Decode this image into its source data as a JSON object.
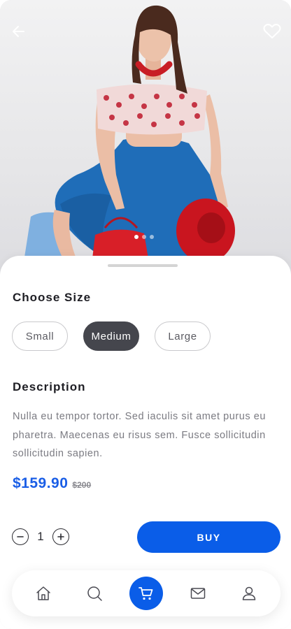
{
  "hero": {
    "back_icon": "arrow-left-icon",
    "favorite_icon": "heart-outline-icon",
    "carousel": {
      "count": 3,
      "active_index": 0
    }
  },
  "size_section": {
    "title": "Choose Size",
    "options": [
      "Small",
      "Medium",
      "Large"
    ],
    "selected": "Medium"
  },
  "description_section": {
    "title": "Description",
    "text": "Nulla eu tempor tortor. Sed iaculis sit amet purus eu pharetra. Maecenas eu risus sem. Fusce sollicitudin sollicitudin sapien."
  },
  "pricing": {
    "price": "$159.90",
    "old_price": "$200"
  },
  "quantity": {
    "value": "1",
    "decrement_icon": "minus-circle-icon",
    "increment_icon": "plus-circle-icon"
  },
  "buy_button": {
    "label": "BUY"
  },
  "bottom_nav": {
    "items": [
      {
        "icon": "home-icon"
      },
      {
        "icon": "search-icon"
      },
      {
        "icon": "cart-icon",
        "active": true
      },
      {
        "icon": "mail-icon"
      },
      {
        "icon": "user-icon"
      }
    ]
  },
  "colors": {
    "accent": "#0a5de8",
    "price": "#1a5ee6",
    "selected_chip": "#45464d",
    "title_text": "#1e1e24",
    "body_text": "#7b7b82"
  }
}
